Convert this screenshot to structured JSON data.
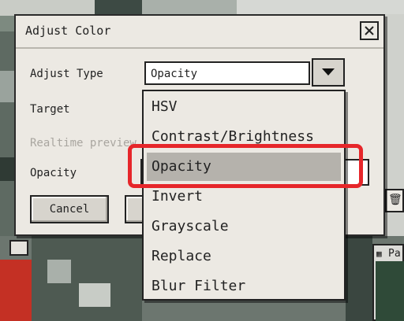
{
  "dialog": {
    "title": "Adjust Color",
    "close_icon": "close-icon",
    "labels": {
      "adjust_type": "Adjust Type",
      "target": "Target",
      "realtime_preview": "Realtime preview",
      "opacity": "Opacity"
    },
    "adjust_type_value": "Opacity",
    "buttons": {
      "cancel": "Cancel"
    }
  },
  "dropdown": {
    "options": [
      "HSV",
      "Contrast/Brightness",
      "Opacity",
      "Invert",
      "Grayscale",
      "Replace",
      "Blur Filter"
    ],
    "selected": "Opacity"
  },
  "background": {
    "panel_label": "Pa",
    "icons": [
      "trash-icon",
      "grid-icon"
    ]
  },
  "colors": {
    "highlight": "#e6262a",
    "dialog_bg": "#ece9e3",
    "selected_option": "#b5b2ac"
  }
}
